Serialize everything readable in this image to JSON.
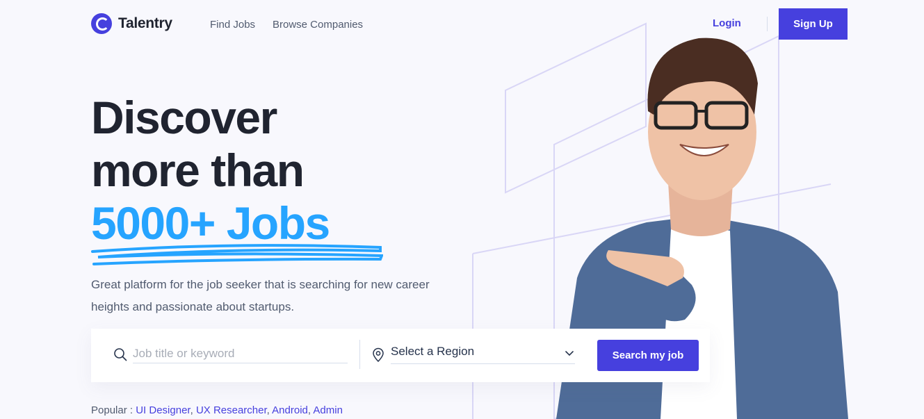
{
  "brand": {
    "name": "Talentry",
    "accent": "#4640de",
    "highlight": "#26a4ff"
  },
  "nav": {
    "find_jobs": "Find Jobs",
    "browse_companies": "Browse Companies"
  },
  "auth": {
    "login": "Login",
    "signup": "Sign Up"
  },
  "hero": {
    "line1": "Discover",
    "line2": "more than",
    "line3": "5000+ Jobs",
    "subtitle": "Great platform for the job seeker that is searching for new career heights and passionate about startups."
  },
  "search": {
    "keyword_placeholder": "Job title or keyword",
    "keyword_value": "",
    "region_selected": "Select a Region",
    "button": "Search my job",
    "icons": [
      "search-icon",
      "location-pin-icon",
      "chevron-down-icon"
    ]
  },
  "popular": {
    "label": "Popular :",
    "tags": [
      "UI Designer",
      "UX Researcher",
      "Android",
      "Admin"
    ]
  }
}
